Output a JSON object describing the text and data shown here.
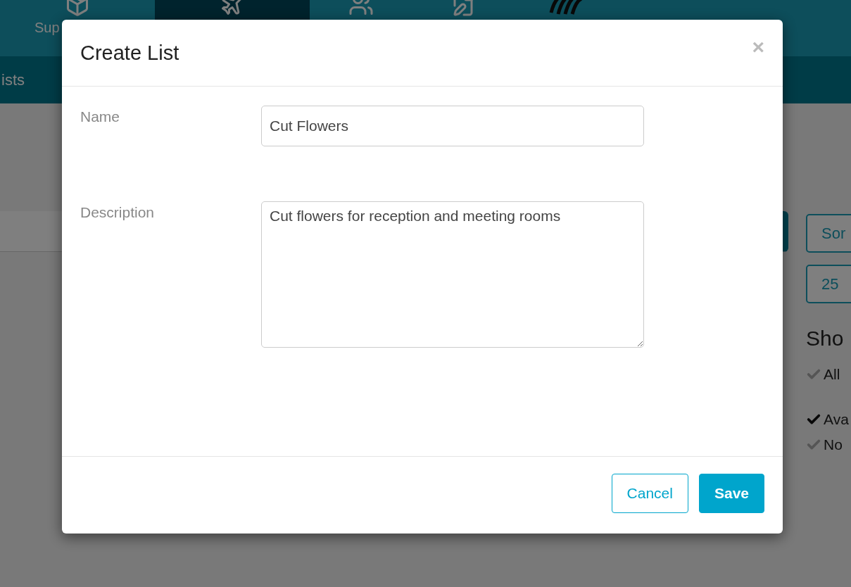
{
  "nav": {
    "items": [
      {
        "label": "Sup",
        "selected": false,
        "kind": "box"
      },
      {
        "selected": true,
        "kind": "plane"
      },
      {
        "selected": false,
        "kind": "people"
      },
      {
        "selected": false,
        "kind": "edit"
      },
      {
        "selected": false,
        "kind": "logo"
      }
    ]
  },
  "subnav": {
    "label": "ists"
  },
  "side": {
    "buttons": [
      "Sor",
      "25"
    ],
    "heading": "Sho",
    "filters": [
      {
        "label": "All",
        "checked": false
      },
      {
        "label": "Ava",
        "checked": true
      },
      {
        "label": "No",
        "checked": false
      }
    ]
  },
  "modal": {
    "title": "Create List",
    "close": "×",
    "fields": [
      {
        "label": "Name",
        "kind": "input",
        "value": "Cut Flowers"
      },
      {
        "label": "Description",
        "kind": "textarea",
        "value": "Cut flowers for reception and meeting rooms"
      }
    ],
    "buttons": [
      {
        "label": "Cancel",
        "kind": "secondary"
      },
      {
        "label": "Save",
        "kind": "primary"
      }
    ]
  }
}
